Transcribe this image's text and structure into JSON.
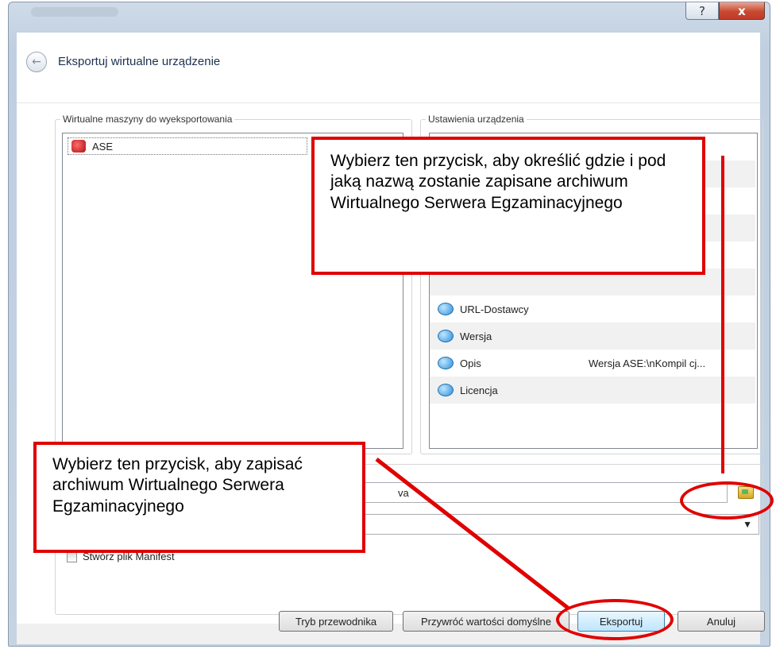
{
  "window": {
    "help_glyph": "?",
    "close_glyph": "x"
  },
  "dialog": {
    "title": "Eksportuj wirtualne urządzenie"
  },
  "vm_group": {
    "label": "Wirtualne maszyny do wyeksportowania",
    "items": [
      {
        "name": "ASE"
      }
    ]
  },
  "settings_group": {
    "label": "Ustawienia urządzenia",
    "properties": [
      {
        "label": "URL-Dostawcy",
        "value": ""
      },
      {
        "label": "Wersja",
        "value": ""
      },
      {
        "label": "Opis",
        "value": "Wersja ASE:\\nKompil cj..."
      },
      {
        "label": "Licencja",
        "value": ""
      }
    ]
  },
  "file": {
    "path_suffix": "va"
  },
  "manifest_checkbox": {
    "label": "Stwórz plik Manifest",
    "checked": false
  },
  "buttons": {
    "guided_mode": "Tryb przewodnika",
    "restore_defaults": "Przywróć wartości domyślne",
    "export": "Eksportuj",
    "cancel": "Anuluj"
  },
  "callouts": {
    "choose_location": "Wybierz ten przycisk, aby określić gdzie i pod jaką nazwą zostanie zapisane archiwum Wirtualnego Serwera Egzaminacyjnego",
    "save_archive": "Wybierz ten przycisk, aby zapisać archiwum Wirtualnego Serwera Egzaminacyjnego"
  },
  "colors": {
    "annotation_red": "#e00000",
    "accent_blue": "#2e8fd8"
  }
}
